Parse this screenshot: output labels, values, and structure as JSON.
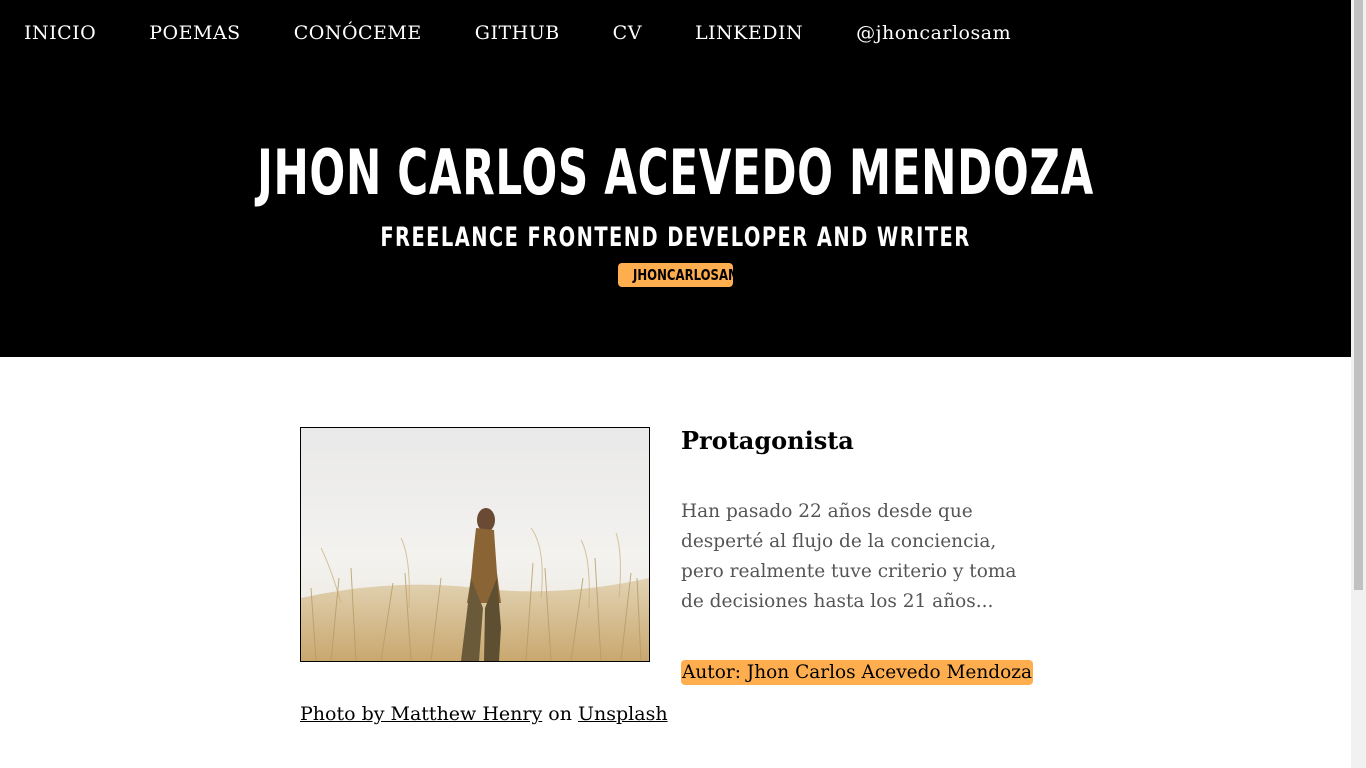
{
  "nav": {
    "items": [
      "INICIO",
      "POEMAS",
      "CONÓCEME",
      "GITHUB",
      "CV",
      "LINKEDIN",
      "@jhoncarlosam"
    ]
  },
  "hero": {
    "title": "JHON CARLOS ACEVEDO MENDOZA",
    "subtitle": "FREELANCE FRONTEND DEVELOPER AND WRITER",
    "badge": "JHONCARLOSAM"
  },
  "post": {
    "image_alt": "person standing in a wheat field",
    "credit": {
      "photo_by": "Photo by Matthew Henry",
      "on": "on",
      "source": "Unsplash"
    },
    "title": "Protagonista",
    "excerpt": "Han pasado 22 años desde que desperté al flujo de la conciencia, pero realmente tuve criterio y toma de decisiones hasta los 21 años...",
    "author": "Autor: Jhon Carlos Acevedo Mendoza"
  },
  "colors": {
    "header_bg": "#000000",
    "accent": "#ffae4f",
    "excerpt_text": "#555555"
  }
}
